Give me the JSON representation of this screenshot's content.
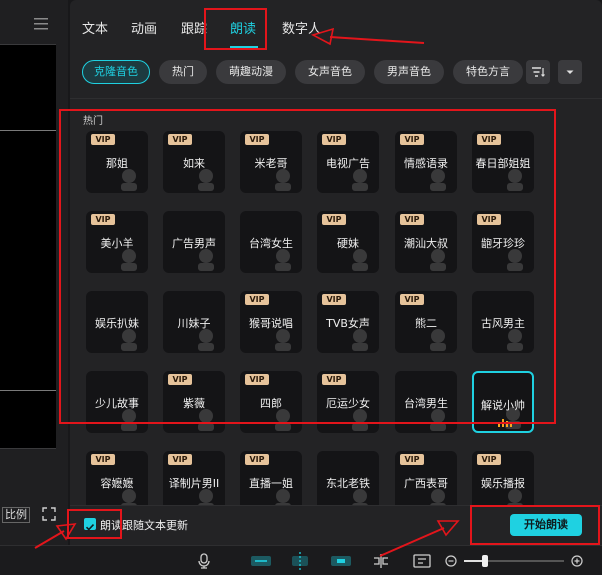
{
  "tabs": [
    {
      "label": "文本"
    },
    {
      "label": "动画"
    },
    {
      "label": "跟踪"
    },
    {
      "label": "朗读"
    },
    {
      "label": "数字人"
    }
  ],
  "active_tab": "朗读",
  "categories": [
    {
      "label": "克隆音色"
    },
    {
      "label": "热门"
    },
    {
      "label": "萌趣动漫"
    },
    {
      "label": "女声音色"
    },
    {
      "label": "男声音色"
    },
    {
      "label": "特色方言"
    }
  ],
  "active_category": "克隆音色",
  "section_label": "热门",
  "vip_label": "VIP",
  "voices": [
    {
      "name": "那姐",
      "vip": true
    },
    {
      "name": "如来",
      "vip": true
    },
    {
      "name": "米老哥",
      "vip": true
    },
    {
      "name": "电视广告",
      "vip": true
    },
    {
      "name": "情感语录",
      "vip": true
    },
    {
      "name": "春日部姐姐",
      "vip": true
    },
    {
      "name": "美小羊",
      "vip": true
    },
    {
      "name": "广告男声",
      "vip": false
    },
    {
      "name": "台湾女生",
      "vip": false
    },
    {
      "name": "硬妹",
      "vip": true
    },
    {
      "name": "潮汕大叔",
      "vip": true
    },
    {
      "name": "龅牙珍珍",
      "vip": true
    },
    {
      "name": "娱乐扒妹",
      "vip": false
    },
    {
      "name": "川妹子",
      "vip": false
    },
    {
      "name": "猴哥说唱",
      "vip": true
    },
    {
      "name": "TVB女声",
      "vip": true
    },
    {
      "name": "熊二",
      "vip": true
    },
    {
      "name": "古风男主",
      "vip": false
    },
    {
      "name": "少儿故事",
      "vip": false
    },
    {
      "name": "紫薇",
      "vip": true
    },
    {
      "name": "四郎",
      "vip": true
    },
    {
      "name": "厄运少女",
      "vip": true
    },
    {
      "name": "台湾男生",
      "vip": false
    },
    {
      "name": "解说小帅",
      "vip": false
    },
    {
      "name": "容嬷嬷",
      "vip": true
    },
    {
      "name": "译制片男II",
      "vip": true
    },
    {
      "name": "直播一姐",
      "vip": true
    },
    {
      "name": "东北老铁",
      "vip": false
    },
    {
      "name": "广西表哥",
      "vip": true
    },
    {
      "name": "娱乐播报",
      "vip": true
    }
  ],
  "selected_voice": "解说小帅",
  "checkbox": {
    "label": "朗读跟随文本更新",
    "checked": true
  },
  "start_button": "开始朗读",
  "left_panel": {
    "ratio_label": "比例"
  },
  "colors": {
    "accent": "#1fd1e1",
    "annotation": "#e3151b",
    "vip_badge": "#e6c39a"
  }
}
